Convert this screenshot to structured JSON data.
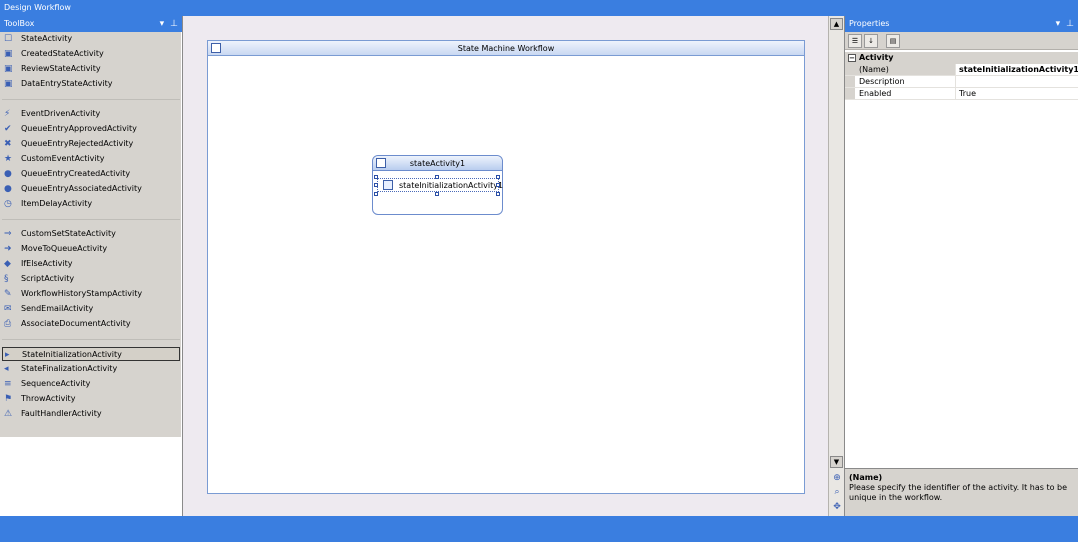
{
  "window": {
    "title": "Design Workflow"
  },
  "toolbox": {
    "title": "ToolBox",
    "groups": [
      {
        "items": [
          {
            "label": "StateActivity",
            "icon": "state-activity-icon"
          },
          {
            "label": "CreatedStateActivity",
            "icon": "created-state-icon"
          },
          {
            "label": "ReviewStateActivity",
            "icon": "review-state-icon"
          },
          {
            "label": "DataEntryStateActivity",
            "icon": "data-entry-state-icon"
          }
        ]
      },
      {
        "items": [
          {
            "label": "EventDrivenActivity",
            "icon": "event-driven-icon"
          },
          {
            "label": "QueueEntryApprovedActivity",
            "icon": "queue-approved-icon"
          },
          {
            "label": "QueueEntryRejectedActivity",
            "icon": "queue-rejected-icon"
          },
          {
            "label": "CustomEventActivity",
            "icon": "custom-event-icon"
          },
          {
            "label": "QueueEntryCreatedActivity",
            "icon": "queue-created-icon"
          },
          {
            "label": "QueueEntryAssociatedActivity",
            "icon": "queue-associated-icon"
          },
          {
            "label": "ItemDelayActivity",
            "icon": "item-delay-icon"
          }
        ]
      },
      {
        "items": [
          {
            "label": "CustomSetStateActivity",
            "icon": "custom-set-state-icon"
          },
          {
            "label": "MoveToQueueActivity",
            "icon": "move-to-queue-icon"
          },
          {
            "label": "IfElseActivity",
            "icon": "if-else-icon"
          },
          {
            "label": "ScriptActivity",
            "icon": "script-icon"
          },
          {
            "label": "WorkflowHistoryStampActivity",
            "icon": "history-stamp-icon"
          },
          {
            "label": "SendEmailActivity",
            "icon": "send-email-icon"
          },
          {
            "label": "AssociateDocumentActivity",
            "icon": "associate-document-icon"
          }
        ]
      },
      {
        "items": [
          {
            "label": "StateInitializationActivity",
            "icon": "state-initialization-icon",
            "selected": true
          },
          {
            "label": "StateFinalizationActivity",
            "icon": "state-finalization-icon"
          },
          {
            "label": "SequenceActivity",
            "icon": "sequence-icon"
          },
          {
            "label": "ThrowActivity",
            "icon": "throw-icon"
          },
          {
            "label": "FaultHandlerActivity",
            "icon": "fault-handler-icon"
          }
        ]
      }
    ]
  },
  "designer": {
    "workflow_title": "State Machine Workflow",
    "state_title": "stateActivity1",
    "child_activity": "stateInitializationActivity1"
  },
  "properties": {
    "title": "Properties",
    "category": "Activity",
    "rows": [
      {
        "name": "(Name)",
        "value": "stateInitializationActivity1",
        "selected": true
      },
      {
        "name": "Description",
        "value": ""
      },
      {
        "name": "Enabled",
        "value": "True"
      }
    ],
    "description_title": "(Name)",
    "description_text": "Please specify the identifier of the activity. It has to be unique in the workflow."
  },
  "colors": {
    "title_bar": "#3a7ee0",
    "panel_gray": "#d6d3ce",
    "workflow_border": "#7a9bd3"
  }
}
